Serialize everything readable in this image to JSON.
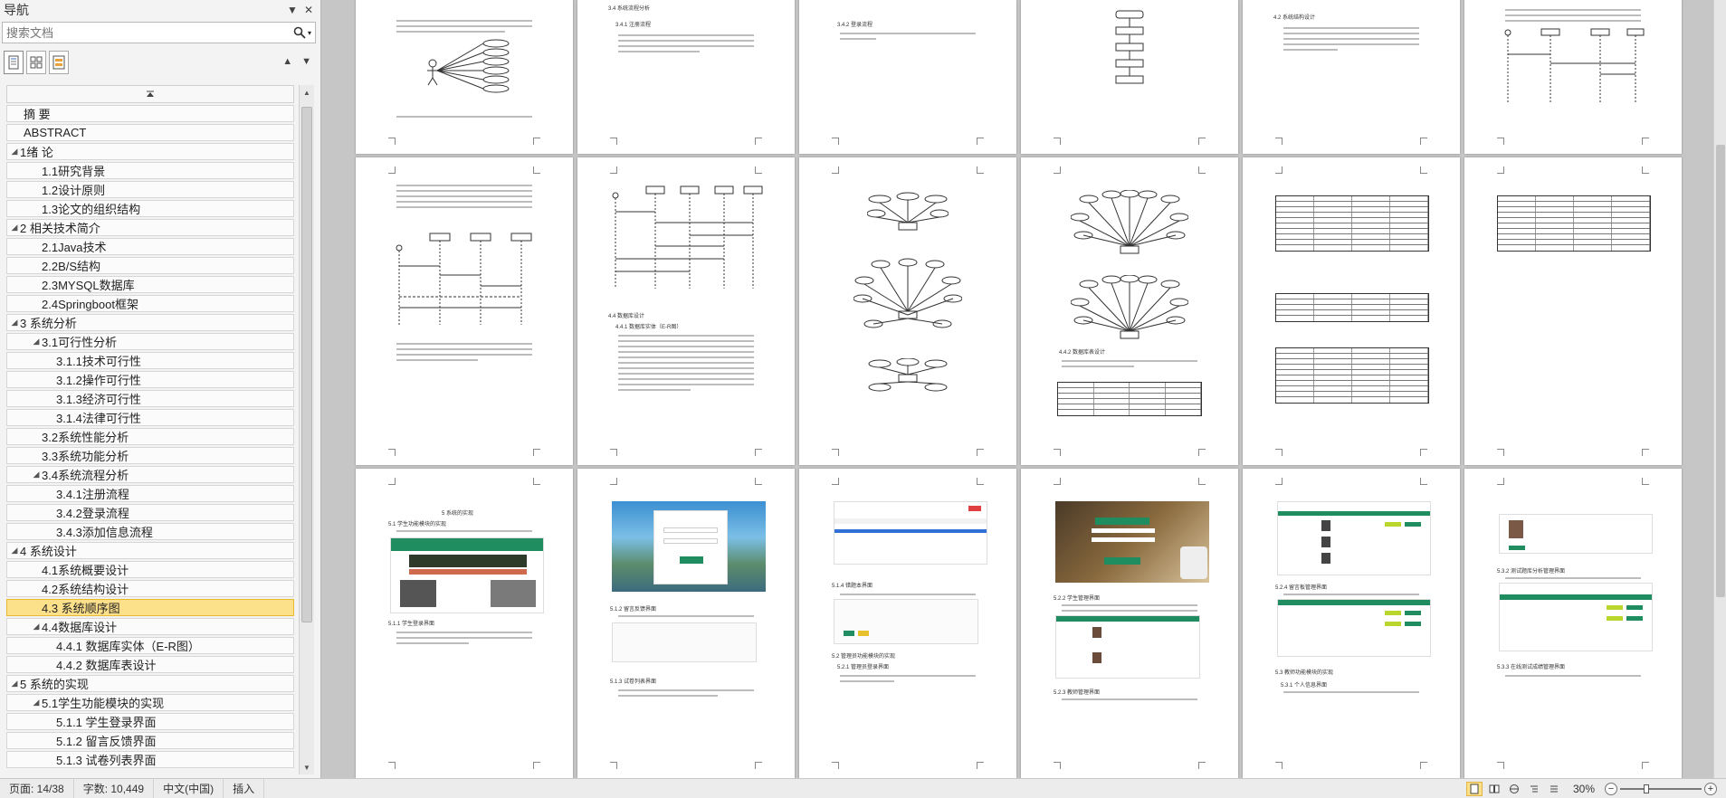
{
  "nav": {
    "title": "导航",
    "search_placeholder": "搜索文档",
    "outline": [
      {
        "label": "摘  要",
        "level": 0,
        "expand": false
      },
      {
        "label": "ABSTRACT",
        "level": 0,
        "expand": false
      },
      {
        "label": "1绪  论",
        "level": 0,
        "expand": true
      },
      {
        "label": "1.1研究背景",
        "level": 1,
        "expand": false
      },
      {
        "label": "1.2设计原则",
        "level": 1,
        "expand": false
      },
      {
        "label": "1.3论文的组织结构",
        "level": 1,
        "expand": false
      },
      {
        "label": "2 相关技术简介",
        "level": 0,
        "expand": true
      },
      {
        "label": "2.1Java技术",
        "level": 1,
        "expand": false
      },
      {
        "label": "2.2B/S结构",
        "level": 1,
        "expand": false
      },
      {
        "label": "2.3MYSQL数据库",
        "level": 1,
        "expand": false
      },
      {
        "label": "2.4Springboot框架",
        "level": 1,
        "expand": false
      },
      {
        "label": "3 系统分析",
        "level": 0,
        "expand": true
      },
      {
        "label": "3.1可行性分析",
        "level": 1,
        "expand": true
      },
      {
        "label": "3.1.1技术可行性",
        "level": 2,
        "expand": false
      },
      {
        "label": "3.1.2操作可行性",
        "level": 2,
        "expand": false
      },
      {
        "label": "3.1.3经济可行性",
        "level": 2,
        "expand": false
      },
      {
        "label": "3.1.4法律可行性",
        "level": 2,
        "expand": false
      },
      {
        "label": "3.2系统性能分析",
        "level": 1,
        "expand": false
      },
      {
        "label": "3.3系统功能分析",
        "level": 1,
        "expand": false
      },
      {
        "label": "3.4系统流程分析",
        "level": 1,
        "expand": true
      },
      {
        "label": "3.4.1注册流程",
        "level": 2,
        "expand": false
      },
      {
        "label": "3.4.2登录流程",
        "level": 2,
        "expand": false
      },
      {
        "label": "3.4.3添加信息流程",
        "level": 2,
        "expand": false
      },
      {
        "label": "4 系统设计",
        "level": 0,
        "expand": true
      },
      {
        "label": "4.1系统概要设计",
        "level": 1,
        "expand": false
      },
      {
        "label": "4.2系统结构设计",
        "level": 1,
        "expand": false
      },
      {
        "label": "4.3 系统顺序图",
        "level": 1,
        "expand": false,
        "selected": true
      },
      {
        "label": "4.4数据库设计",
        "level": 1,
        "expand": true
      },
      {
        "label": "4.4.1 数据库实体（E-R图）",
        "level": 2,
        "expand": false
      },
      {
        "label": "4.4.2 数据库表设计",
        "level": 2,
        "expand": false
      },
      {
        "label": "5 系统的实现",
        "level": 0,
        "expand": true
      },
      {
        "label": "5.1学生功能模块的实现",
        "level": 1,
        "expand": true
      },
      {
        "label": "5.1.1 学生登录界面",
        "level": 2,
        "expand": false
      },
      {
        "label": "5.1.2 留言反馈界面",
        "level": 2,
        "expand": false
      },
      {
        "label": "5.1.3 试卷列表界面",
        "level": 2,
        "expand": false
      }
    ]
  },
  "pages": {
    "p1_heading": "",
    "p2_heading": "3.4 系统流程分析",
    "p2_sub": "3.4.1 注册流程",
    "p3_sub": "3.4.2 登录流程",
    "p5_heading": "4.2 系统结构设计",
    "p8_heading": "4.4 数据库设计",
    "p8_sub": "4.4.1 数据库实体（E-R图）",
    "p10_sub": "4.4.2 数据库表设计",
    "p13_heading": "5 系统的实现",
    "p13_sub": "5.1 学生功能模块的实现",
    "p13_sub2": "5.1.1 学生登录界面",
    "p14_sub": "5.1.2 留言反馈界面",
    "p14_sub2": "5.1.3 试卷列表界面",
    "p15_sub": "5.1.4 错题本界面",
    "p15_sub2": "5.2 管理员功能模块的实现",
    "p15_sub3": "5.2.1 管理员登录界面",
    "p16_sub": "5.2.2 学生管理界面",
    "p16_sub2": "5.2.3 教师管理界面",
    "p17_sub": "5.2.4 留言板管理界面",
    "p17_sub2": "5.3 教师功能模块的实现",
    "p17_sub3": "5.3.1 个人信息界面",
    "p18_sub": "5.3.2 测试题库分析管理界面",
    "p18_sub2": "5.3.3 在线测试成绩管理界面"
  },
  "status": {
    "page": "页面: 14/38",
    "words": "字数: 10,449",
    "lang": "中文(中国)",
    "mode": "插入",
    "zoom": "30%"
  }
}
